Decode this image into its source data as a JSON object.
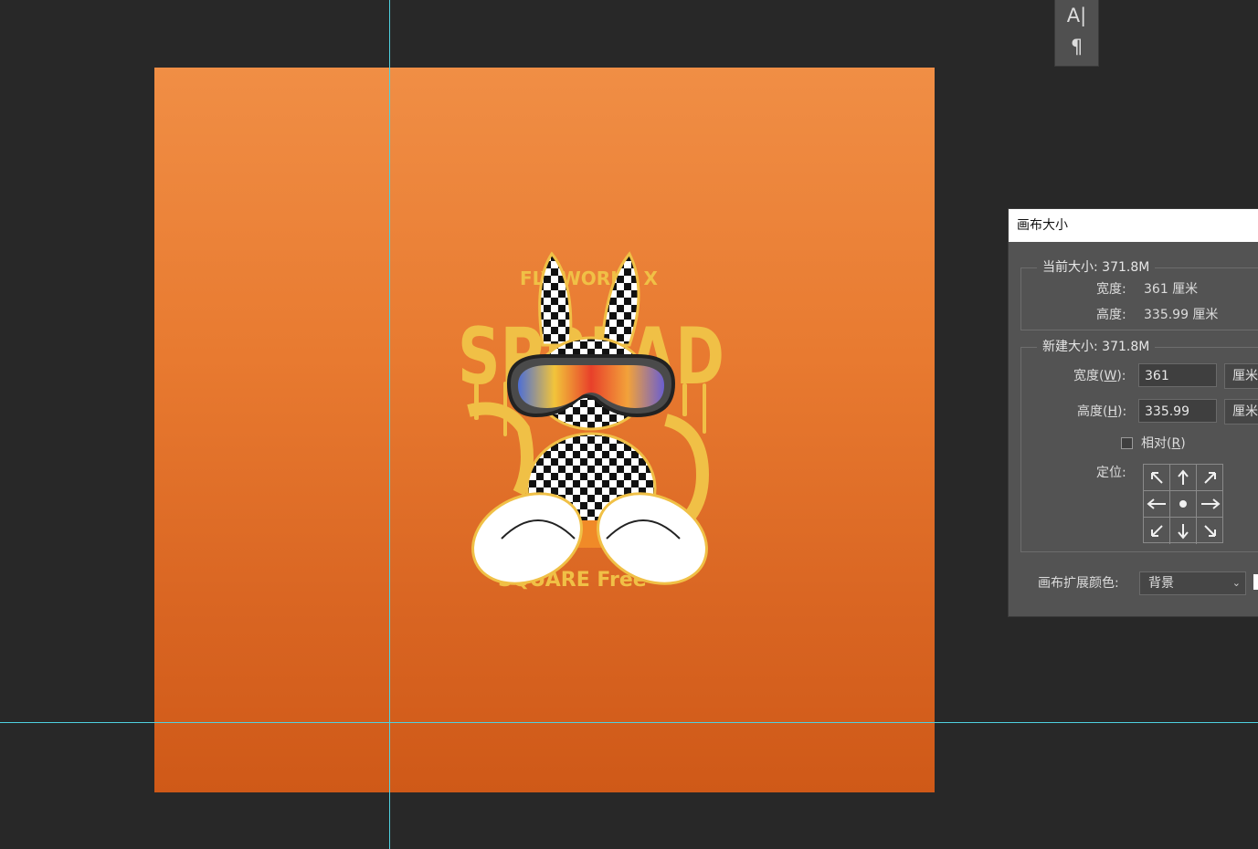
{
  "tool_panel": {
    "character_icon": "A|",
    "paragraph_icon": "¶"
  },
  "artwork": {
    "top_text": "FLY WORLD X",
    "main_text_1": "SPREAD",
    "bottom_text": "SQUARE Free"
  },
  "dialog": {
    "title": "画布大小",
    "current_size": {
      "legend": "当前大小: 371.8M",
      "width_label": "宽度:",
      "width_value": "361 厘米",
      "height_label": "高度:",
      "height_value": "335.99 厘米"
    },
    "new_size": {
      "legend": "新建大小: 371.8M",
      "width_label": "宽度(W):",
      "width_value": "361",
      "width_unit": "厘米",
      "height_label": "高度(H):",
      "height_value": "335.99",
      "height_unit": "厘米",
      "relative_label": "相对(R)",
      "relative_checked": false,
      "anchor_label": "定位:"
    },
    "extension_color_label": "画布扩展颜色:",
    "extension_color_value": "背景",
    "extension_swatch_color": "#ffffff"
  }
}
